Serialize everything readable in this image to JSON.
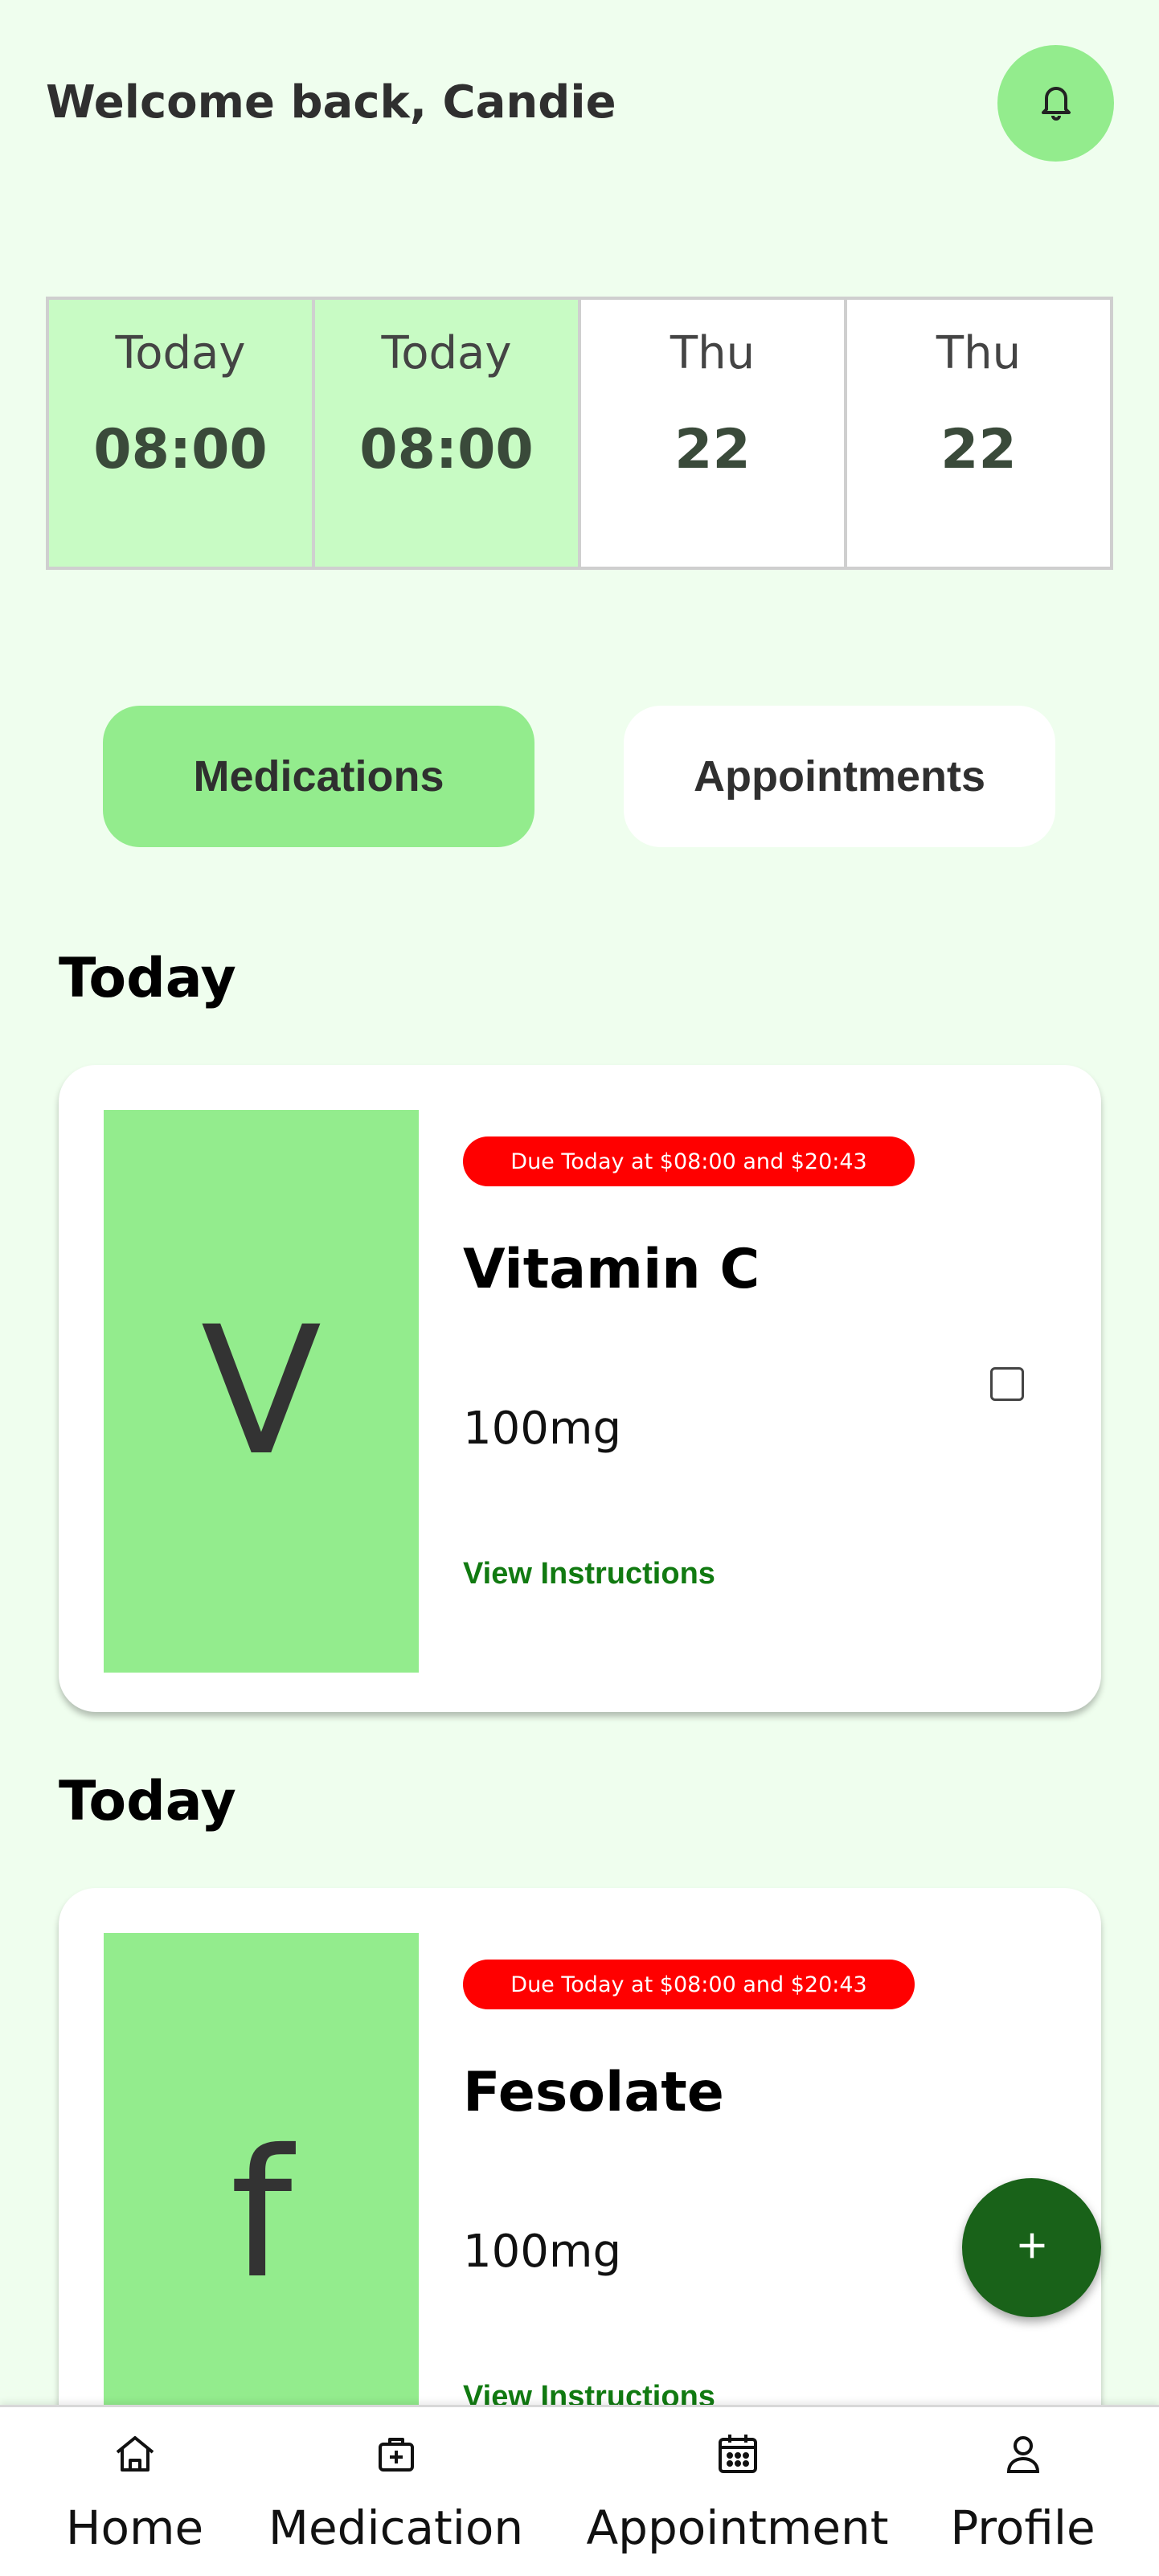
{
  "header": {
    "welcome": "Welcome back, Candie",
    "bell_icon": "bell-icon"
  },
  "date_strip": [
    {
      "label": "Today",
      "value": "08:00",
      "state": "active"
    },
    {
      "label": "Today",
      "value": "08:00",
      "state": "active"
    },
    {
      "label": "Thu",
      "value": "22",
      "state": "inactive"
    },
    {
      "label": "Thu",
      "value": "22",
      "state": "inactive"
    }
  ],
  "tabs": {
    "medications": "Medications",
    "appointments": "Appointments",
    "selected": "medications"
  },
  "medications": [
    {
      "section": "Today",
      "letter": "V",
      "due": "Due Today at $08:00 and $20:43",
      "name": "Vitamin C",
      "dose": "100mg",
      "link": "View Instructions",
      "checked": false
    },
    {
      "section": "Today",
      "letter": "f",
      "due": "Due Today at $08:00 and $20:43",
      "name": "Fesolate",
      "dose": "100mg",
      "link": "View Instructions",
      "checked": false
    }
  ],
  "fab": {
    "icon": "plus-icon"
  },
  "bottom_nav": [
    {
      "label": "Home",
      "icon": "home-icon"
    },
    {
      "label": "Medication",
      "icon": "medkit-icon"
    },
    {
      "label": "Appointment",
      "icon": "calendar-icon"
    },
    {
      "label": "Profile",
      "icon": "user-icon"
    }
  ],
  "colors": {
    "background": "#effeee",
    "accent": "#93ec8d",
    "date_active": "#c8fbc4",
    "badge": "#ff0000",
    "link": "#117a11",
    "fab": "#196219"
  }
}
